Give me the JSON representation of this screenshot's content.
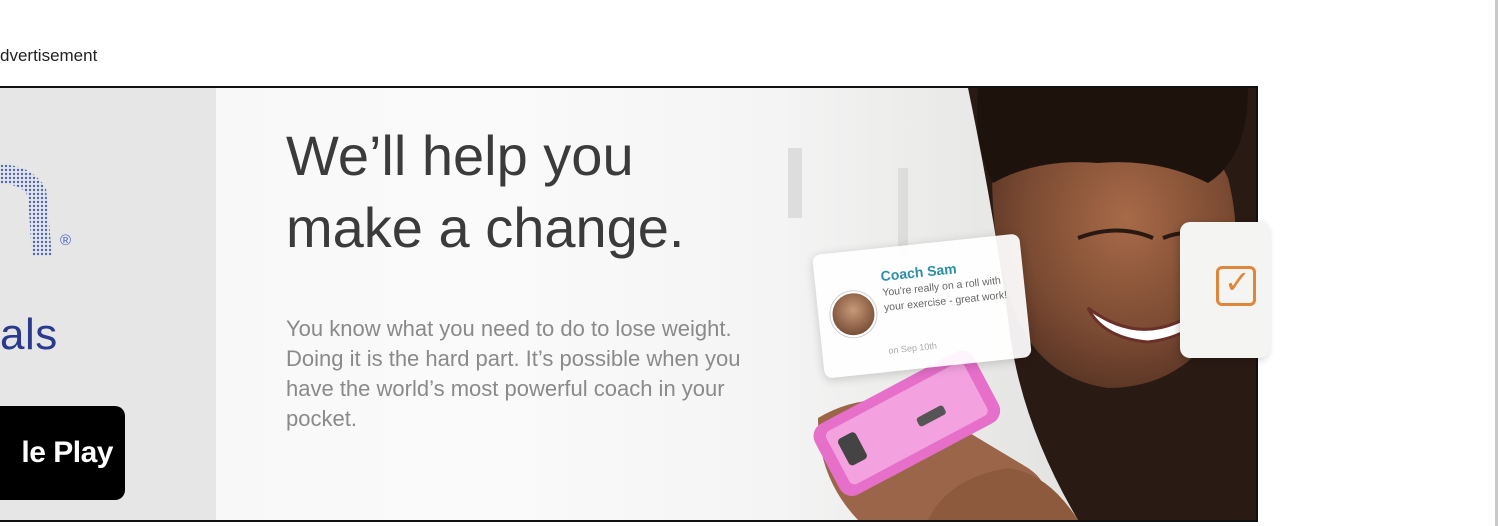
{
  "ad_label": "dvertisement",
  "brand": {
    "word": "als",
    "registered_mark": "®",
    "store_button_label": "le Play",
    "logo_icon": "dotted-arch-logo-icon"
  },
  "headline": {
    "line1": "We’ll help you",
    "line2": "make a change."
  },
  "body_copy": "You know what you need to do to lose weight. Doing it is the hard part. It’s possible when you have the world’s most powerful coach in your pocket.",
  "coach_card": {
    "name": "Coach Sam",
    "message": "You're really on a roll with your exercise - great work!",
    "date": "on Sep 10th"
  },
  "check_card": {
    "icon": "checkbox-icon",
    "check_glyph": "✓"
  },
  "colors": {
    "brand_blue": "#2a3a8f",
    "logo_dots": "#4a67c8",
    "coach_teal": "#2c8fa6",
    "check_orange": "#e0863a",
    "phone_pink": "#e56fc9"
  }
}
